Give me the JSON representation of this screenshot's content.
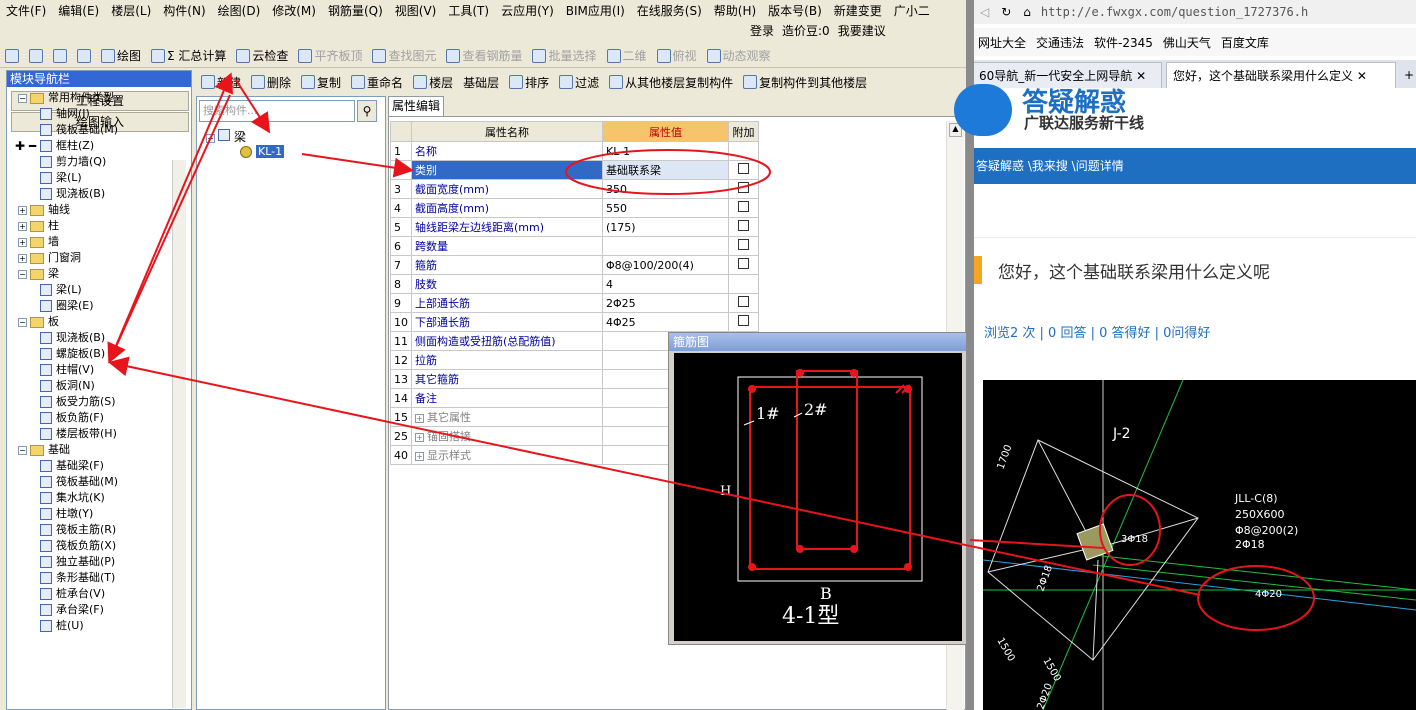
{
  "menu": [
    "文件(F)",
    "编辑(E)",
    "楼层(L)",
    "构件(N)",
    "绘图(D)",
    "修改(M)",
    "钢筋量(Q)",
    "视图(V)",
    "工具(T)",
    "云应用(Y)",
    "BIM应用(I)",
    "在线服务(S)",
    "帮助(H)",
    "版本号(B)",
    "新建变更",
    "广小二"
  ],
  "login": {
    "login": "登录",
    "cost": "造价豆:0",
    "suggest": "我要建议"
  },
  "toolbar": [
    "绘图",
    "Σ 汇总计算",
    "云检查",
    "平齐板顶",
    "查找图元",
    "查看钢筋量",
    "批量选择",
    "二维",
    "俯视",
    "动态观察"
  ],
  "toolbar2": [
    "新建",
    "删除",
    "复制",
    "重命名",
    "楼层",
    "基础层",
    "排序",
    "过滤",
    "从其他楼层复制构件",
    "复制构件到其他楼层"
  ],
  "nav": {
    "title": "模块导航栏",
    "btn_setup": "工程设置",
    "btn_draw": "绘图输入",
    "tree": [
      {
        "label": "常用构件类型",
        "level": 0,
        "type": "folder"
      },
      {
        "label": "轴网(J)",
        "level": 1
      },
      {
        "label": "筏板基础(M)",
        "level": 1
      },
      {
        "label": "框柱(Z)",
        "level": 1
      },
      {
        "label": "剪力墙(Q)",
        "level": 1
      },
      {
        "label": "梁(L)",
        "level": 1
      },
      {
        "label": "现浇板(B)",
        "level": 1
      },
      {
        "label": "轴线",
        "level": 0,
        "type": "folder"
      },
      {
        "label": "柱",
        "level": 0,
        "type": "folder"
      },
      {
        "label": "墙",
        "level": 0,
        "type": "folder"
      },
      {
        "label": "门窗洞",
        "level": 0,
        "type": "folder"
      },
      {
        "label": "梁",
        "level": 0,
        "type": "folder"
      },
      {
        "label": "梁(L)",
        "level": 1
      },
      {
        "label": "圈梁(E)",
        "level": 1
      },
      {
        "label": "板",
        "level": 0,
        "type": "folder"
      },
      {
        "label": "现浇板(B)",
        "level": 1
      },
      {
        "label": "螺旋板(B)",
        "level": 1
      },
      {
        "label": "柱帽(V)",
        "level": 1
      },
      {
        "label": "板洞(N)",
        "level": 1
      },
      {
        "label": "板受力筋(S)",
        "level": 1
      },
      {
        "label": "板负筋(F)",
        "level": 1
      },
      {
        "label": "楼层板带(H)",
        "level": 1
      },
      {
        "label": "基础",
        "level": 0,
        "type": "folder"
      },
      {
        "label": "基础梁(F)",
        "level": 1
      },
      {
        "label": "筏板基础(M)",
        "level": 1
      },
      {
        "label": "集水坑(K)",
        "level": 1
      },
      {
        "label": "柱墩(Y)",
        "level": 1
      },
      {
        "label": "筏板主筋(R)",
        "level": 1
      },
      {
        "label": "筏板负筋(X)",
        "level": 1
      },
      {
        "label": "独立基础(P)",
        "level": 1
      },
      {
        "label": "条形基础(T)",
        "level": 1
      },
      {
        "label": "桩承台(V)",
        "level": 1
      },
      {
        "label": "承台梁(F)",
        "level": 1
      },
      {
        "label": "桩(U)",
        "level": 1
      }
    ]
  },
  "component": {
    "search_placeholder": "搜索构件...",
    "root": "梁",
    "item": "KL-1"
  },
  "props": {
    "tab": "属性编辑",
    "headers": [
      "属性名称",
      "属性值",
      "附加"
    ],
    "rows": [
      {
        "n": "1",
        "name": "名称",
        "val": "KL-1",
        "chk": false
      },
      {
        "n": "2",
        "name": "类别",
        "val": "基础联系梁",
        "chk": true
      },
      {
        "n": "3",
        "name": "截面宽度(mm)",
        "val": "350",
        "chk": true
      },
      {
        "n": "4",
        "name": "截面高度(mm)",
        "val": "550",
        "chk": true
      },
      {
        "n": "5",
        "name": "轴线距梁左边线距离(mm)",
        "val": "(175)",
        "chk": true
      },
      {
        "n": "6",
        "name": "跨数量",
        "val": "",
        "chk": true
      },
      {
        "n": "7",
        "name": "箍筋",
        "val": "Φ8@100/200(4)",
        "chk": true
      },
      {
        "n": "8",
        "name": "肢数",
        "val": "4",
        "chk": false
      },
      {
        "n": "9",
        "name": "上部通长筋",
        "val": "2Φ25",
        "chk": true
      },
      {
        "n": "10",
        "name": "下部通长筋",
        "val": "4Φ25",
        "chk": true
      },
      {
        "n": "11",
        "name": "侧面构造或受扭筋(总配筋值)",
        "val": "",
        "chk": false
      },
      {
        "n": "12",
        "name": "拉筋",
        "val": "",
        "chk": false
      },
      {
        "n": "13",
        "name": "其它箍筋",
        "val": "",
        "chk": false
      },
      {
        "n": "14",
        "name": "备注",
        "val": "",
        "chk": false
      },
      {
        "n": "15",
        "name": "其它属性",
        "val": "",
        "chk": false,
        "group": true
      },
      {
        "n": "25",
        "name": "锚固搭接",
        "val": "",
        "chk": false,
        "group": true
      },
      {
        "n": "40",
        "name": "显示样式",
        "val": "",
        "chk": false,
        "group": true
      }
    ]
  },
  "dialog": {
    "title": "箍筋图",
    "l1": "1#",
    "l2": "2#",
    "side": "H",
    "bottom": "B",
    "type": "4-1型"
  },
  "browser": {
    "url": "http://e.fwxgx.com/question_1727376.h",
    "bookmarks": [
      "网址大全",
      "交通违法",
      "软件-2345",
      "佛山天气",
      "百度文库"
    ],
    "tab1": "60导航_新一代安全上网导航",
    "tab2": "您好，这个基础联系梁用什么定义",
    "logo": "答疑解惑",
    "slogan": "广联达服务新干线",
    "crumb": "答疑解惑 \\我来搜 \\问题详情",
    "question": "您好，这个基础联系梁用什么定义呢",
    "stats": "浏览2 次 | 0 回答 | 0 答得好 | 0问得好",
    "cad": {
      "axis": "J-2",
      "tag1": "JLL-C(8)",
      "tag2": "250X600",
      "tag3": "Φ8@200(2)",
      "tag4": "2Φ18",
      "bar1": "3Φ18",
      "bar2": "4Φ20",
      "d1": "1700",
      "d2": "1500",
      "d3": "1500",
      "d4": "2Φ18",
      "d5": "2Φ20"
    }
  },
  "colors": {
    "accent": "#316ac5",
    "header": "#f6c46a",
    "annot": "#e8141c",
    "crumb": "#1e6fc2"
  }
}
